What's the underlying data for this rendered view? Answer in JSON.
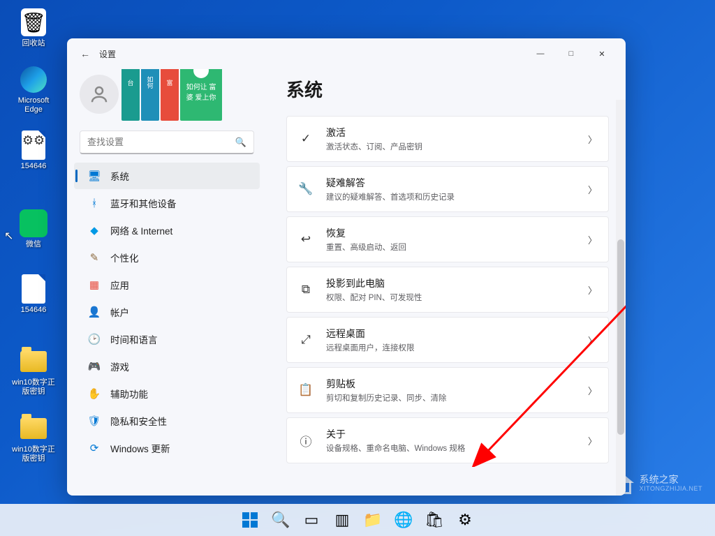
{
  "desktop_icons": [
    {
      "id": "recycle-bin",
      "label": "回收站"
    },
    {
      "id": "edge",
      "label": "Microsoft Edge"
    },
    {
      "id": "file1",
      "label": "154646"
    },
    {
      "id": "wechat",
      "label": "微信"
    },
    {
      "id": "file2",
      "label": "154646"
    },
    {
      "id": "folder1",
      "label": "win10数字正版密钥"
    },
    {
      "id": "folder2",
      "label": "win10数字正版密钥"
    }
  ],
  "wallpaper_logo": {
    "title": "系统之家",
    "sub": "XITONGZHIJIA.NET"
  },
  "window": {
    "title": "设置",
    "back_aria": "返回",
    "controls": {
      "min": "—",
      "max": "□",
      "close": "✕"
    }
  },
  "search": {
    "placeholder": "查找设置"
  },
  "sidebar": [
    {
      "icon": "🖥",
      "cls": "ic-system",
      "label": "系统",
      "active": true,
      "name": "system"
    },
    {
      "icon": "ᚼ",
      "cls": "ic-bt",
      "label": "蓝牙和其他设备",
      "name": "bluetooth"
    },
    {
      "icon": "◆",
      "cls": "ic-net",
      "label": "网络 & Internet",
      "name": "network"
    },
    {
      "icon": "✎",
      "cls": "ic-pers",
      "label": "个性化",
      "name": "personalization"
    },
    {
      "icon": "▦",
      "cls": "ic-apps",
      "label": "应用",
      "name": "apps"
    },
    {
      "icon": "👤",
      "cls": "ic-acc",
      "label": "帐户",
      "name": "accounts"
    },
    {
      "icon": "🕑",
      "cls": "ic-time",
      "label": "时间和语言",
      "name": "time-language"
    },
    {
      "icon": "🎮",
      "cls": "ic-game",
      "label": "游戏",
      "name": "gaming"
    },
    {
      "icon": "✋",
      "cls": "ic-acc2",
      "label": "辅助功能",
      "name": "accessibility"
    },
    {
      "icon": "🛡",
      "cls": "ic-priv",
      "label": "隐私和安全性",
      "name": "privacy"
    },
    {
      "icon": "⟳",
      "cls": "ic-upd",
      "label": "Windows 更新",
      "name": "windows-update"
    }
  ],
  "main": {
    "title": "系统",
    "cards": [
      {
        "icon": "✓",
        "title": "激活",
        "sub": "激活状态、订阅、产品密钥",
        "name": "activation"
      },
      {
        "icon": "🔧",
        "title": "疑难解答",
        "sub": "建议的疑难解答、首选项和历史记录",
        "name": "troubleshoot"
      },
      {
        "icon": "↩",
        "title": "恢复",
        "sub": "重置、高级启动、返回",
        "name": "recovery"
      },
      {
        "icon": "⧉",
        "title": "投影到此电脑",
        "sub": "权限、配对 PIN、可发现性",
        "name": "project"
      },
      {
        "icon": "⤢",
        "title": "远程桌面",
        "sub": "远程桌面用户，连接权限",
        "name": "remote-desktop"
      },
      {
        "icon": "📋",
        "title": "剪贴板",
        "sub": "剪切和复制历史记录、同步、清除",
        "name": "clipboard"
      },
      {
        "icon": "ⓘ",
        "title": "关于",
        "sub": "设备规格、重命名电脑、Windows 规格",
        "name": "about"
      }
    ]
  },
  "taskbar": [
    {
      "name": "start",
      "type": "start"
    },
    {
      "name": "search",
      "icon": "🔍"
    },
    {
      "name": "taskview",
      "icon": "▭"
    },
    {
      "name": "widgets",
      "icon": "▥"
    },
    {
      "name": "explorer",
      "icon": "📁"
    },
    {
      "name": "edge",
      "icon": "🌐"
    },
    {
      "name": "store",
      "icon": "🛍"
    },
    {
      "name": "settings",
      "icon": "⚙"
    }
  ],
  "books": [
    "台",
    "如何",
    "富",
    "如何让 富婆 爱上你"
  ]
}
